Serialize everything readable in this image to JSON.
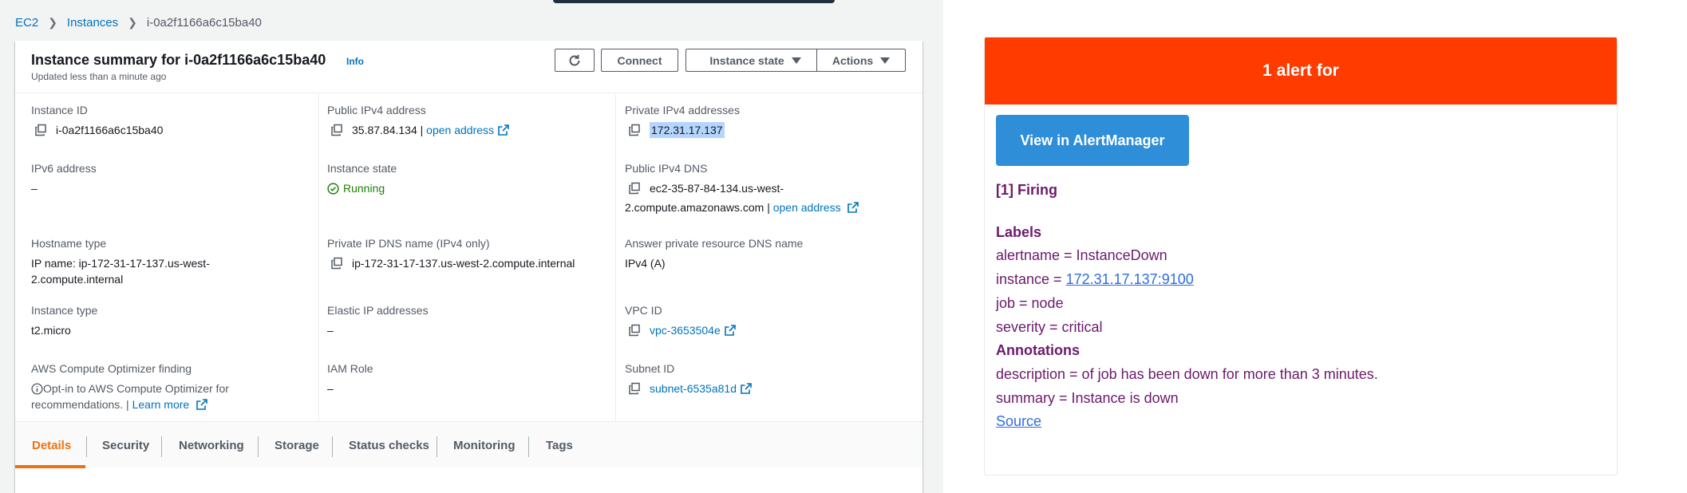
{
  "breadcrumb": {
    "ec2": "EC2",
    "instances": "Instances",
    "current": "i-0a2f1166a6c15ba40"
  },
  "summary": {
    "title": "Instance summary for i-0a2f1166a6c15ba40",
    "info": "Info",
    "updated": "Updated less than a minute ago"
  },
  "toolbar": {
    "refresh_icon": "refresh-icon",
    "connect": "Connect",
    "instance_state": "Instance state",
    "actions": "Actions"
  },
  "fields": {
    "instance_id": {
      "label": "Instance ID",
      "value": "i-0a2f1166a6c15ba40"
    },
    "public_ipv4": {
      "label": "Public IPv4 address",
      "value": "35.87.84.134 |",
      "link": "open address"
    },
    "private_ipv4": {
      "label": "Private IPv4 addresses",
      "value": "172.31.17.137"
    },
    "ipv6": {
      "label": "IPv6 address",
      "value": "–"
    },
    "instance_state": {
      "label": "Instance state",
      "value": "Running"
    },
    "public_dns": {
      "label": "Public IPv4 DNS",
      "value_line1": "ec2-35-87-84-134.us-west-",
      "value_line2": "2.compute.amazonaws.com |",
      "link": "open address"
    },
    "hostname_type": {
      "label": "Hostname type",
      "value_line1": "IP name: ip-172-31-17-137.us-west-",
      "value_line2": "2.compute.internal"
    },
    "private_dns": {
      "label": "Private IP DNS name (IPv4 only)",
      "value": "ip-172-31-17-137.us-west-2.compute.internal"
    },
    "answer_dns": {
      "label": "Answer private resource DNS name",
      "value": "IPv4 (A)"
    },
    "instance_type": {
      "label": "Instance type",
      "value": "t2.micro"
    },
    "elastic_ip": {
      "label": "Elastic IP addresses",
      "value": "–"
    },
    "vpc_id": {
      "label": "VPC ID",
      "value": "vpc-3653504e"
    },
    "optimizer": {
      "label": "AWS Compute Optimizer finding",
      "value_line1": "Opt-in to AWS Compute Optimizer for",
      "value_line2": "recommendations. |",
      "link": "Learn more"
    },
    "iam_role": {
      "label": "IAM Role",
      "value": "–"
    },
    "subnet_id": {
      "label": "Subnet ID",
      "value": "subnet-6535a81d"
    }
  },
  "tabs": [
    "Details",
    "Security",
    "Networking",
    "Storage",
    "Status checks",
    "Monitoring",
    "Tags"
  ],
  "alert": {
    "header": "1 alert for",
    "button": "View in AlertManager",
    "firing": "[1] Firing",
    "labels_heading": "Labels",
    "alertname": "alertname = InstanceDown",
    "instance_prefix": "instance =",
    "instance_link": "172.31.17.137:9100",
    "job": "job = node",
    "severity": "severity = critical",
    "annotations_heading": "Annotations",
    "description": "description = of job has been down for more than 3 minutes.",
    "summary": "summary = Instance is down",
    "source": "Source"
  },
  "colors": {
    "aws_link": "#0073bb",
    "aws_orange": "#ec7211",
    "running_green": "#1d8102",
    "alert_red": "#ff3b00",
    "alert_button": "#2e8ed8",
    "alert_text": "#6b1a6b"
  }
}
